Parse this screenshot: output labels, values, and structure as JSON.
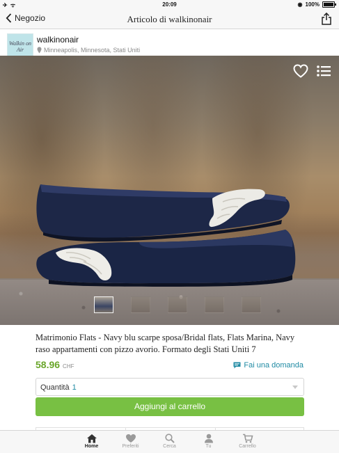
{
  "status_bar": {
    "time": "20:09",
    "battery": "100%"
  },
  "nav": {
    "back_label": "Negozio",
    "title": "Articolo di walkinonair"
  },
  "shop": {
    "logo_text": "Walkin on Air",
    "name": "walkinonair",
    "location": "Minneapolis, Minnesota, Stati Uniti"
  },
  "gallery": {
    "thumb_count": 5,
    "active_index": 0
  },
  "product": {
    "title": "Matrimonio Flats - Navy blu scarpe sposa/Bridal flats, Flats Marina, Navy raso appartamenti con pizzo avorio. Formato degli Stati Uniti 7",
    "price": "58.96",
    "currency": "CHF",
    "ask_label": "Fai una domanda"
  },
  "quantity": {
    "label": "Quantità",
    "value": "1"
  },
  "cart": {
    "add_label": "Aggiungi al carrello"
  },
  "tabs": [
    {
      "label": "Home",
      "icon": "home-icon",
      "active": true
    },
    {
      "label": "Preferiti",
      "icon": "heart-icon",
      "active": false
    },
    {
      "label": "Cerca",
      "icon": "search-icon",
      "active": false
    },
    {
      "label": "Tu",
      "icon": "user-icon",
      "active": false
    },
    {
      "label": "Carrello",
      "icon": "cart-icon",
      "active": false
    }
  ],
  "colors": {
    "accent": "#1f8aa3",
    "price": "#6aa62a",
    "button": "#78c043"
  }
}
